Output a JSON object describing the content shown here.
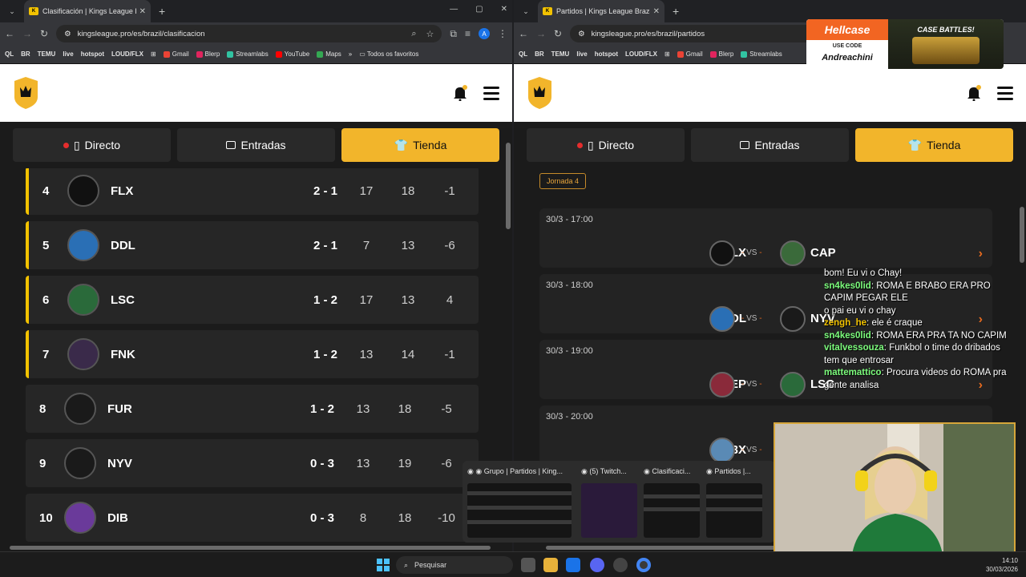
{
  "left_window": {
    "tab_title": "Clasificación | Kings League Bra...",
    "url": "kingsleague.pro/es/brazil/clasificacion",
    "profile_initial": "A",
    "bookmarks": [
      "QL",
      "BR",
      "TEMU",
      "live",
      "hotspot",
      "LOUD/FLX",
      "Gmail",
      "Blerp",
      "Streamlabs",
      "YouTube",
      "Maps"
    ],
    "bookmarks_more": "»",
    "all_favorites": "Todos os favoritos",
    "nav": {
      "live": "Directo",
      "tickets": "Entradas",
      "shop": "Tienda"
    },
    "standings": [
      {
        "pos": "4",
        "team": "FLX",
        "record": "2 - 1",
        "gf": "17",
        "ga": "18",
        "gd": "-1",
        "crest_color": "#111111",
        "highlight": true
      },
      {
        "pos": "5",
        "team": "DDL",
        "record": "2 - 1",
        "gf": "7",
        "ga": "13",
        "gd": "-6",
        "crest_color": "#2a6fb5",
        "highlight": true
      },
      {
        "pos": "6",
        "team": "LSC",
        "record": "1 - 2",
        "gf": "17",
        "ga": "13",
        "gd": "4",
        "crest_color": "#2a6a3a",
        "highlight": true
      },
      {
        "pos": "7",
        "team": "FNK",
        "record": "1 - 2",
        "gf": "13",
        "ga": "14",
        "gd": "-1",
        "crest_color": "#3a2a4a",
        "highlight": true
      },
      {
        "pos": "8",
        "team": "FUR",
        "record": "1 - 2",
        "gf": "13",
        "ga": "18",
        "gd": "-5",
        "crest_color": "#1a1a1a",
        "highlight": false
      },
      {
        "pos": "9",
        "team": "NYV",
        "record": "0 - 3",
        "gf": "13",
        "ga": "19",
        "gd": "-6",
        "crest_color": "#1a1a1a",
        "highlight": false
      },
      {
        "pos": "10",
        "team": "DIB",
        "record": "0 - 3",
        "gf": "8",
        "ga": "18",
        "gd": "-10",
        "crest_color": "#6a3a9a",
        "highlight": false
      }
    ]
  },
  "right_window": {
    "tab_title": "Partidos | Kings League Brazil",
    "url": "kingsleague.pro/es/brazil/partidos",
    "profile_initial": "A",
    "bookmarks": [
      "QL",
      "BR",
      "TEMU",
      "live",
      "hotspot",
      "LOUD/FLX",
      "Gmail",
      "Blerp",
      "Streamlabs"
    ],
    "nav": {
      "live": "Directo",
      "tickets": "Entradas",
      "shop": "Tienda"
    },
    "round_label": "Jornada 4",
    "vs_label": "VS",
    "matches": [
      {
        "time": "30/3 - 17:00",
        "home": "FLX",
        "away": "CAP",
        "home_color": "#111111",
        "away_color": "#3a6a3a"
      },
      {
        "time": "30/3 - 18:00",
        "home": "DDL",
        "away": "NYV",
        "home_color": "#2a6fb5",
        "away_color": "#1a1a1a"
      },
      {
        "time": "30/3 - 19:00",
        "home": "DEP",
        "away": "LSC",
        "home_color": "#8a2a3a",
        "away_color": "#2a6a3a"
      },
      {
        "time": "30/3 - 20:00",
        "home": "G3X",
        "away": "",
        "home_color": "#5a8ab5",
        "away_color": ""
      }
    ]
  },
  "overlay_ad": {
    "brand": "Hellcase",
    "use_code_label": "USE CODE",
    "code": "Andreachini",
    "promo": "CASE BATTLES!"
  },
  "chat": [
    {
      "user": "",
      "text": "bom! Eu vi o Chay!",
      "color": "#ffffff"
    },
    {
      "user": "sn4kes0lid",
      "text": "ROMA E BRABO ERA PRO CAPIM PEGAR ELE",
      "color": "#7cfc7c"
    },
    {
      "user": "",
      "text": "o pai eu vi o chay",
      "color": "#3a3aff"
    },
    {
      "user": "zengh_he",
      "text": "ele é craque",
      "color": "#f2c200"
    },
    {
      "user": "sn4kes0lid",
      "text": "ROMA ERA PRA TA NO CAPIM",
      "color": "#7cfc7c"
    },
    {
      "user": "vitalvessouza",
      "text": "Funkbol o time do dribados tem que entrosar",
      "color": "#7cfc7c"
    },
    {
      "user": "mattemattico",
      "text": "Procura videos do ROMA pra gente analisa",
      "color": "#7cfc7c"
    }
  ],
  "taskbar": {
    "search_placeholder": "Pesquisar",
    "time": "14:10",
    "date": "30/03/2026",
    "thumbnails": [
      {
        "label": "Grupo | Partidos | King..."
      },
      {
        "label": "(5) Twitch..."
      },
      {
        "label": "Clasificaci..."
      },
      {
        "label": "Partidos |..."
      }
    ]
  }
}
